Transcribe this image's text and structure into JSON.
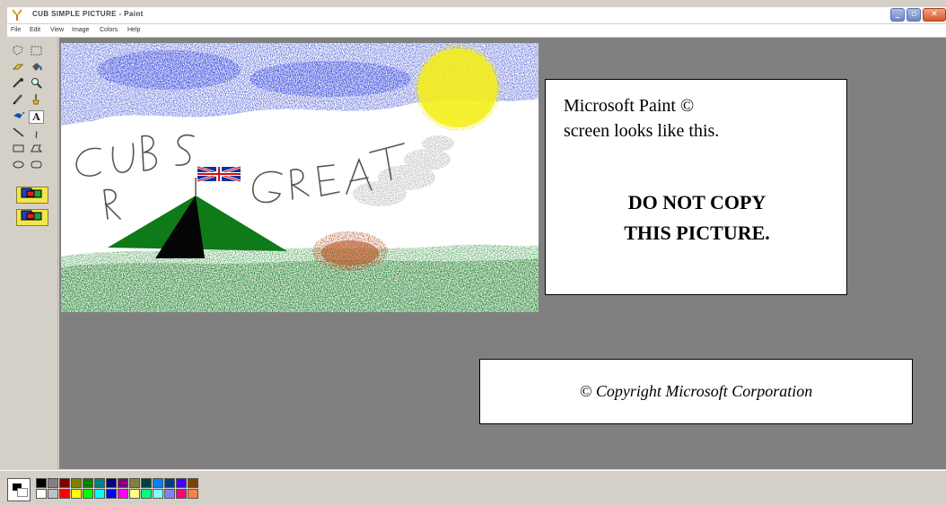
{
  "window": {
    "title": "CUB SIMPLE PICTURE - Paint"
  },
  "menu": [
    {
      "label": "File"
    },
    {
      "label": "Edit"
    },
    {
      "label": "View"
    },
    {
      "label": "Image"
    },
    {
      "label": "Colors"
    },
    {
      "label": "Help"
    }
  ],
  "tools": {
    "text_tool_glyph": "A",
    "curve_tool_glyph": "≀"
  },
  "note": {
    "line1": "Microsoft Paint ©",
    "line2": "screen looks like this.",
    "warning_line1": "DO NOT COPY",
    "warning_line2": "THIS PICTURE."
  },
  "copyright": {
    "text": "© Copyright Microsoft Corporation"
  },
  "palette": {
    "foreground": "#000000",
    "background": "#ffffff",
    "colors_top": [
      "#000000",
      "#808080",
      "#800000",
      "#808000",
      "#008000",
      "#008080",
      "#000080",
      "#800080",
      "#808040",
      "#004040",
      "#0080ff",
      "#004080",
      "#4000ff",
      "#804000"
    ],
    "colors_bottom": [
      "#ffffff",
      "#c0c0c0",
      "#ff0000",
      "#ffff00",
      "#00ff00",
      "#00ffff",
      "#0000ff",
      "#ff00ff",
      "#ffff80",
      "#00ff80",
      "#80ffff",
      "#8080ff",
      "#ff0080",
      "#ff8040"
    ]
  },
  "drawing": {
    "handwriting": [
      "CUBS",
      "R",
      "GREAT"
    ]
  }
}
